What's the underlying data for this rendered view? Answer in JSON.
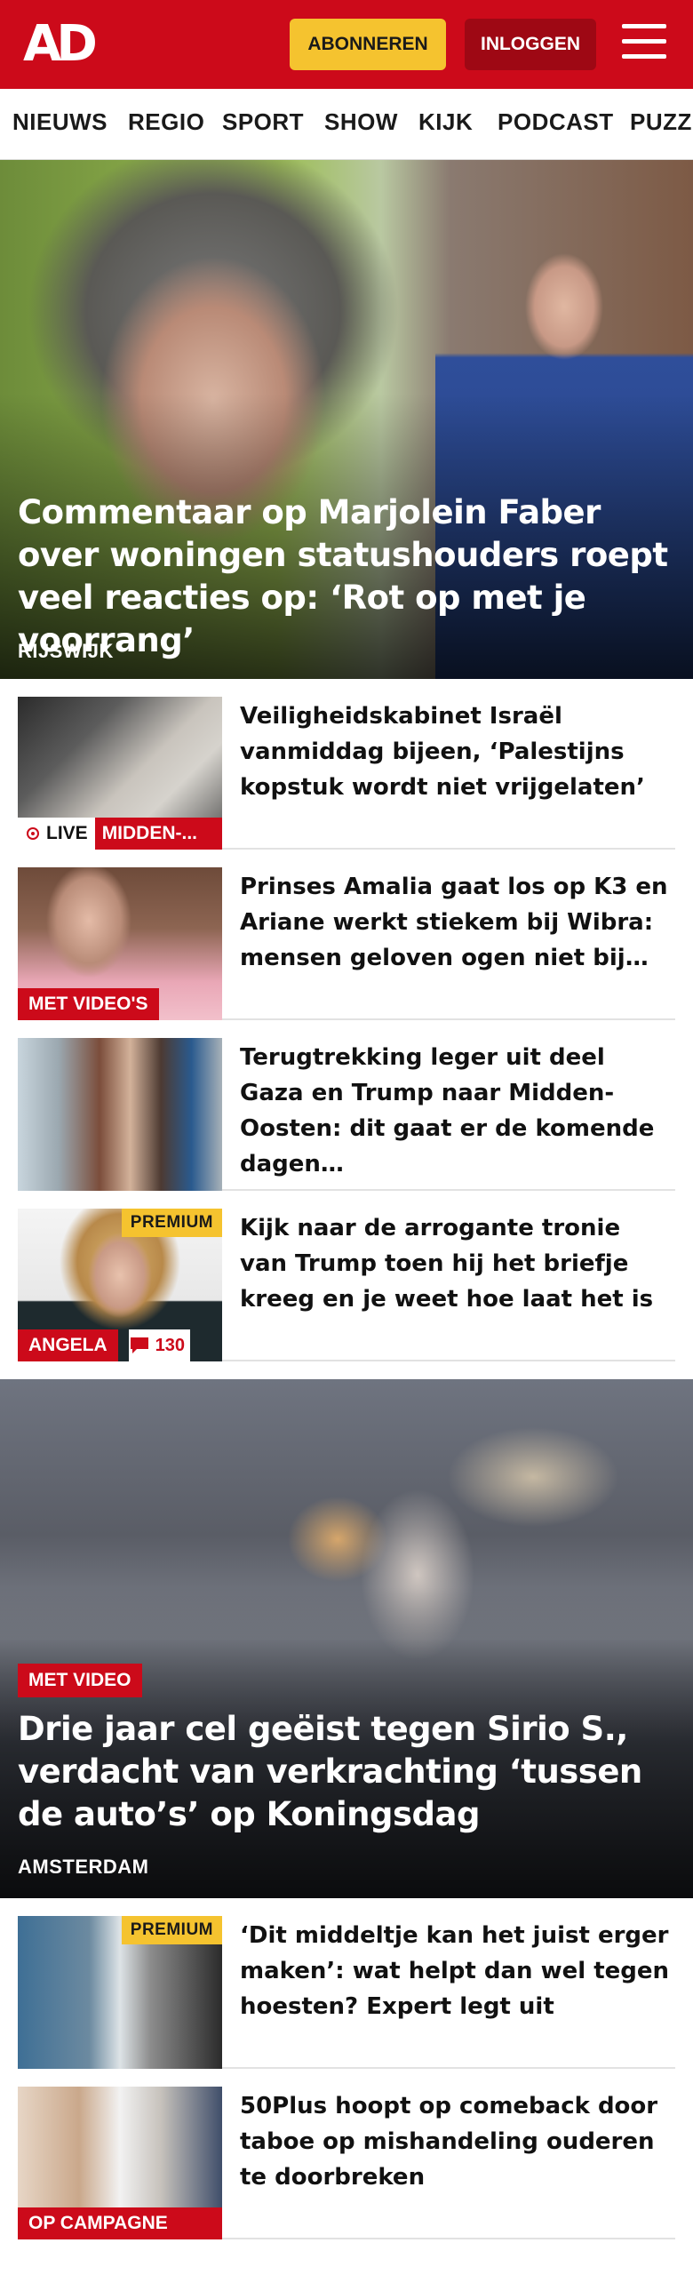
{
  "header": {
    "logo": "AD",
    "subscribe_label": "ABONNEREN",
    "login_label": "INLOGGEN",
    "menu_icon": "hamburger-menu-icon",
    "brand_color": "#cc0a1a",
    "subscribe_color": "#f5c32f"
  },
  "nav": {
    "items": [
      "NIEUWS",
      "REGIO",
      "SPORT",
      "SHOW",
      "KIJK",
      "PODCAST",
      "PUZZ"
    ]
  },
  "hero": {
    "title": "Commentaar op Marjolein Faber over woningen statushouders roept veel reacties op: ‘Rot op met je voorrang’",
    "tag": "RIJSWIJK"
  },
  "articles": [
    {
      "title": "Veiligheidskabinet Israël vanmiddag bijeen, ‘Palestijns kopstuk wordt niet vrijgelaten’",
      "live_label": "LIVE",
      "category": "MIDDEN-..."
    },
    {
      "title": "Prinses Amalia gaat los op K3 en Ariane werkt stiekem bij Wibra: mensen geloven ogen niet bij…",
      "badge": "MET VIDEO'S"
    },
    {
      "title": "Terugtrekking leger uit deel Gaza en Trump naar Midden-Oosten: dit gaat er de komende dagen…"
    },
    {
      "title": "Kijk naar de arrogante tronie van Trump toen hij het briefje kreeg en je weet hoe laat het is",
      "premium": "PREMIUM",
      "author": "ANGELA",
      "comments": "130",
      "comment_icon": "comment-bubble-icon"
    }
  ],
  "video": {
    "badge": "MET VIDEO",
    "title": "Drie jaar cel geëist tegen Sirio S., verdacht van verkrachting ‘tussen de auto’s’ op Koningsdag",
    "tag": "AMSTERDAM"
  },
  "articles2": [
    {
      "title": "‘Dit middeltje kan het juist erger maken’: wat helpt dan wel tegen hoesten? Expert legt uit",
      "premium": "PREMIUM"
    },
    {
      "title": "50Plus hoopt op comeback door taboe op mishandeling ouderen te doorbreken",
      "badge": "OP CAMPAGNE MET"
    }
  ]
}
